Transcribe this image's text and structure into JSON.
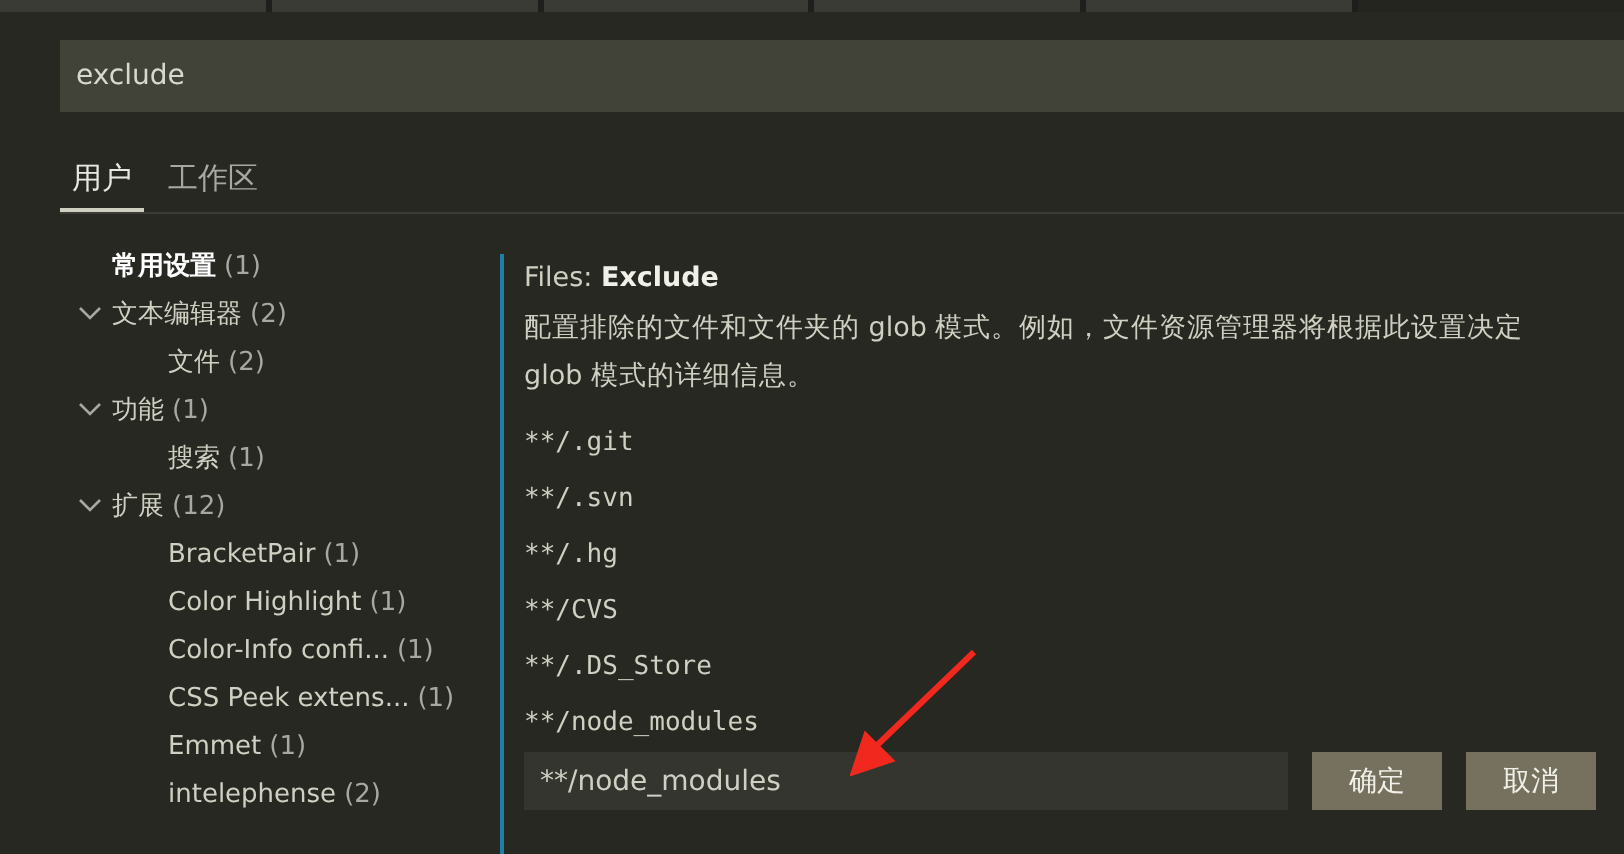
{
  "search": {
    "value": "exclude"
  },
  "scope_tabs": [
    {
      "label": "用户",
      "selected": true
    },
    {
      "label": "工作区",
      "selected": false
    }
  ],
  "tree": [
    {
      "label": "常用设置",
      "count": "(1)",
      "selected": true
    },
    {
      "label": "文本编辑器",
      "count": "(2)",
      "selected": false,
      "expanded": true,
      "children": [
        {
          "label": "文件",
          "count": "(2)",
          "selected": false
        }
      ]
    },
    {
      "label": "功能",
      "count": "(1)",
      "selected": false,
      "expanded": true,
      "children": [
        {
          "label": "搜索",
          "count": "(1)",
          "selected": false
        }
      ]
    },
    {
      "label": "扩展",
      "count": "(12)",
      "selected": false,
      "expanded": true,
      "children": [
        {
          "label": "BracketPair",
          "count": "(1)",
          "selected": false
        },
        {
          "label": "Color Highlight",
          "count": "(1)",
          "selected": false
        },
        {
          "label": "Color-Info confi...",
          "count": "(1)",
          "selected": false
        },
        {
          "label": "CSS Peek extens...",
          "count": "(1)",
          "selected": false
        },
        {
          "label": "Emmet",
          "count": "(1)",
          "selected": false
        },
        {
          "label": "intelephense",
          "count": "(2)",
          "selected": false
        }
      ]
    }
  ],
  "setting": {
    "category": "Files:",
    "name": "Exclude",
    "description": "配置排除的文件和文件夹的 glob 模式。例如，文件资源管理器将根据此设置决定",
    "description_2": "glob 模式的详细信息。",
    "patterns": [
      "**/.git",
      "**/.svn",
      "**/.hg",
      "**/CVS",
      "**/.DS_Store",
      "**/node_modules"
    ],
    "edit_value": "**/node_modules",
    "buttons": [
      "确定",
      "取消"
    ]
  }
}
